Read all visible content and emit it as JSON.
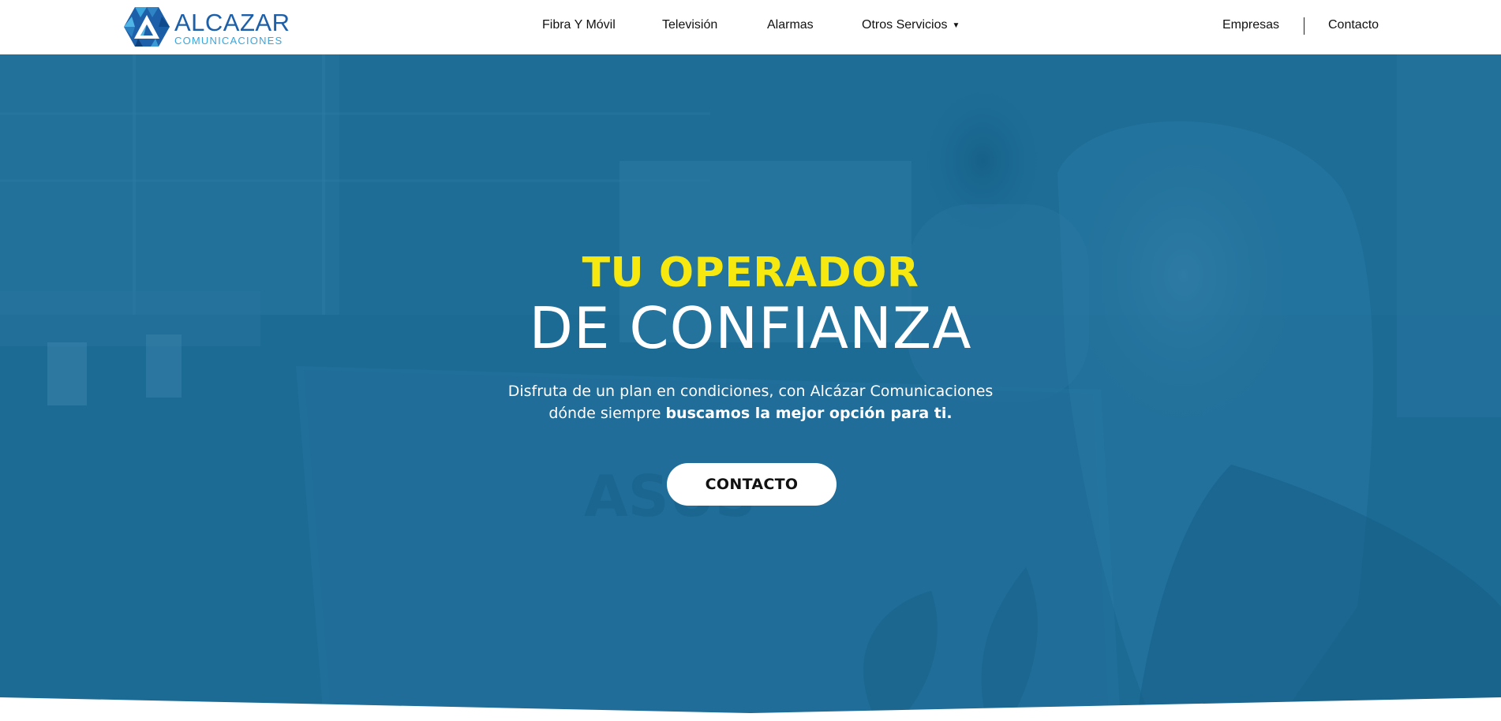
{
  "header": {
    "logo": {
      "name": "ALCAZAR",
      "tagline": "COMUNICACIONES",
      "brand_color": "#1d5fa8",
      "tagline_color": "#39a6dc"
    },
    "nav": {
      "fibra_movil": "Fibra Y Móvil",
      "television": "Televisión",
      "alarmas": "Alarmas",
      "otros_servicios": "Otros Servicios",
      "otros_servicios_caret": "▼"
    },
    "secondary_nav": {
      "empresas": "Empresas",
      "contacto": "Contacto"
    }
  },
  "hero": {
    "title_highlight": "TU OPERADOR",
    "title_main": "DE CONFIANZA",
    "description_line1": "Disfruta de un plan en condiciones,  con Alcázar Comunicaciones",
    "description_line2_prefix": "dónde siempre ",
    "description_line2_bold": "buscamos la mejor opción para ti.",
    "cta_label": "CONTACTO",
    "overlay_color": "#1c6b95",
    "highlight_color": "#f7e90f"
  },
  "icons": {
    "logo_mark": "hexagon-triangles-icon",
    "dropdown": "caret-down-icon"
  }
}
